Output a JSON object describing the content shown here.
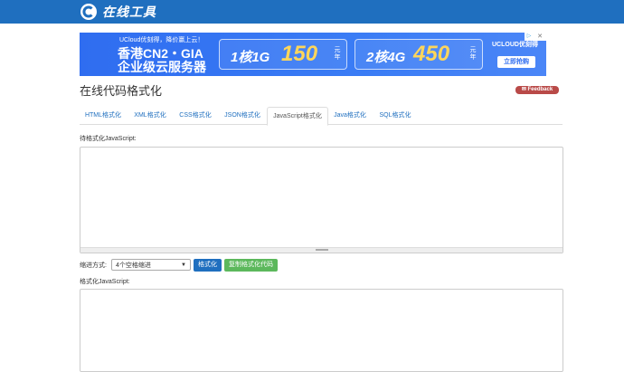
{
  "header": {
    "logo_text": "在线工具",
    "brand_color": "#1f6fbf"
  },
  "ad": {
    "tagline": "UCloud优刻得，降价赢上云！",
    "title": "香港CN2・GIA",
    "subtitle": "企业级云服务器",
    "offer1": {
      "spec": "1核1G",
      "price": "150",
      "unit": "元年"
    },
    "offer2": {
      "spec": "2核4G",
      "price": "450",
      "unit": "元年"
    },
    "brand": "UCLOUD优刻得",
    "cta": "立即抢购",
    "close": "✕",
    "info_icon": "▷"
  },
  "page": {
    "title": "在线代码格式化",
    "feedback": "✉ Feedback"
  },
  "tabs": [
    {
      "label": "HTML格式化"
    },
    {
      "label": "XML格式化"
    },
    {
      "label": "CSS格式化"
    },
    {
      "label": "JSON格式化"
    },
    {
      "label": "JavaScript格式化"
    },
    {
      "label": "Java格式化"
    },
    {
      "label": "SQL格式化"
    }
  ],
  "input_section": {
    "label": "待格式化JavaScript:",
    "value": ""
  },
  "controls": {
    "indent_label": "缩进方式:",
    "indent_selected": "4个空格缩进",
    "format_button": "格式化",
    "copy_button": "复制格式化代码"
  },
  "output_section": {
    "label": "格式化JavaScript:",
    "value": ""
  }
}
